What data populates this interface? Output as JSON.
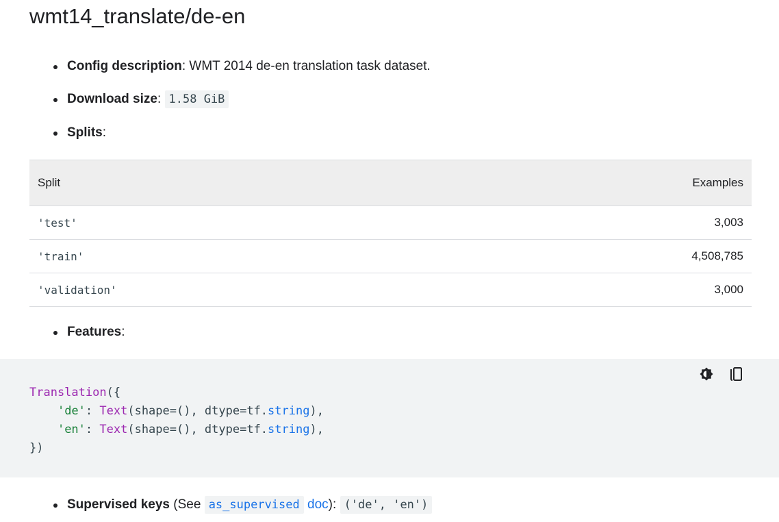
{
  "page": {
    "title": "wmt14_translate/de-en"
  },
  "bullets": {
    "config_label": "Config description",
    "config_text": ": WMT 2014 de-en translation task dataset.",
    "download_label": "Download size",
    "download_sep": ": ",
    "download_value": "1.58 GiB",
    "splits_label": "Splits",
    "splits_sep": ":",
    "features_label": "Features",
    "features_sep": ":"
  },
  "splits_table": {
    "headers": [
      "Split",
      "Examples"
    ],
    "rows": [
      {
        "split": "'test'",
        "examples": "3,003"
      },
      {
        "split": "'train'",
        "examples": "4,508,785"
      },
      {
        "split": "'validation'",
        "examples": "3,000"
      }
    ]
  },
  "code": {
    "l1_fn": "Translation",
    "l1_rest": "({",
    "l2_indent": "    ",
    "l2_key": "'de'",
    "l2_colon": ": ",
    "l2_fn": "Text",
    "l2_args": "(shape=(), dtype=tf.",
    "l2_type": "string",
    "l2_end": "),",
    "l3_indent": "    ",
    "l3_key": "'en'",
    "l3_colon": ": ",
    "l3_fn": "Text",
    "l3_args": "(shape=(), dtype=tf.",
    "l3_type": "string",
    "l3_end": "),",
    "l4": "})",
    "icons": [
      "theme-toggle-icon",
      "copy-icon"
    ]
  },
  "supervised": {
    "label": "Supervised keys",
    "pre": " (See ",
    "code_link": "as_supervised",
    "doc_link": "doc",
    "post": "): ",
    "value": "('de', 'en')"
  },
  "colors": {
    "code_bg": "#f1f3f4",
    "link": "#1a73e8",
    "function": "#9c27b0",
    "string": "#188038"
  }
}
